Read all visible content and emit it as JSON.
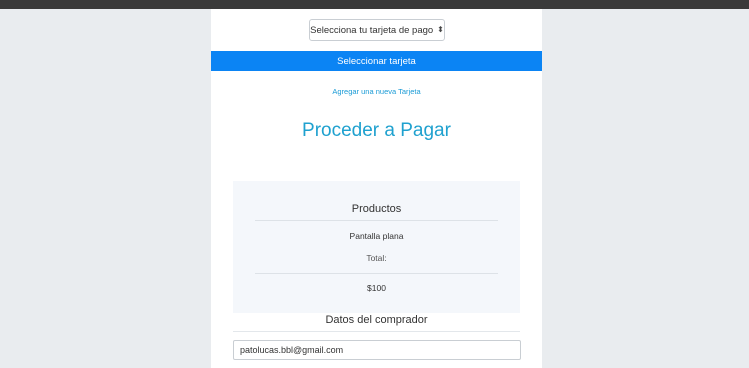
{
  "payment": {
    "card_select": {
      "selected": "Selecciona tu tarjeta de pago",
      "icon": "select-arrows-icon"
    },
    "select_button_label": "Seleccionar tarjeta",
    "add_card_link": "Agregar una nueva Tarjeta",
    "proceed_title": "Proceder a Pagar"
  },
  "products": {
    "title": "Productos",
    "items": [
      {
        "name": "Pantalla plana"
      }
    ],
    "total_label": "Total:",
    "total_value": "$100"
  },
  "buyer": {
    "title": "Datos del comprador",
    "email_value": "patolucas.bbl@gmail.com"
  },
  "colors": {
    "accent": "#0b84f4",
    "title_blue": "#1fa1cf",
    "background": "#e9ecef",
    "box_background": "#f4f7fb"
  }
}
